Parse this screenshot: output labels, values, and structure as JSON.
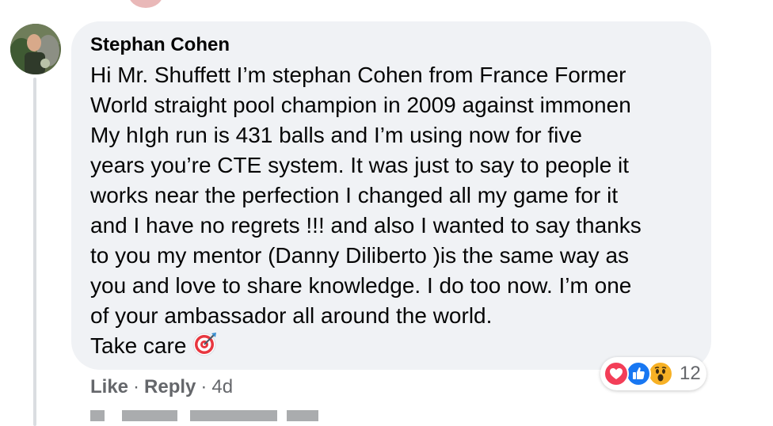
{
  "comment": {
    "author": "Stephan Cohen",
    "lines": [
      "Hi Mr. Shuffett I’m stephan Cohen from France Former",
      "World straight pool champion in 2009 against immonen",
      "My hIgh run is 431 balls and I’m using now for five",
      "years you’re CTE system. It was just to say to people it",
      "works near the perfection I changed all my game for it",
      "and I have no regrets !!! and also I wanted to say thanks",
      "to you my mentor (Danny Diliberto )is the same way as",
      "you and love to share knowledge. I do too now. I’m one",
      "of your ambassador all around the world.",
      "Take care"
    ],
    "emoji": "direct-hit-target-icon"
  },
  "reactions": {
    "icons": [
      "love-icon",
      "like-icon",
      "wow-icon"
    ],
    "count": "12"
  },
  "actions": {
    "like_label": "Like",
    "reply_label": "Reply",
    "separator": "·",
    "time": "4d"
  },
  "colors": {
    "bubble": "#f0f2f5",
    "meta_text": "#65676b",
    "love": "#f33e58",
    "like": "#1877f2",
    "wow": "#f7b125"
  }
}
